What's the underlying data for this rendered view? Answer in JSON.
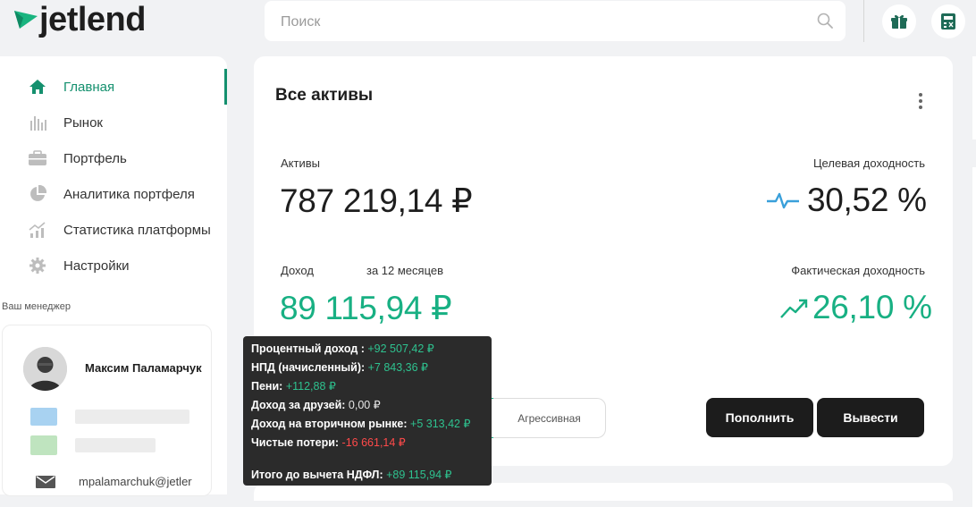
{
  "app": {
    "logo_text": "jetlend"
  },
  "search": {
    "placeholder": "Поиск"
  },
  "sidebar": {
    "items": [
      {
        "label": "Главная"
      },
      {
        "label": "Рынок"
      },
      {
        "label": "Портфель"
      },
      {
        "label": "Аналитика портфеля"
      },
      {
        "label": "Статистика платформы"
      },
      {
        "label": "Настройки"
      }
    ],
    "manager_label": "Ваш менеджер",
    "manager_name": "Максим Паламарчук",
    "manager_email": "mpalamarchuk@jetler"
  },
  "main": {
    "title": "Все активы",
    "assets_label": "Активы",
    "assets_value": "787 219,14 ₽",
    "target_label": "Целевая доходность",
    "target_value": "30,52 %",
    "income_label": "Доход",
    "income_period": "за 12 месяцев",
    "income_value": "89 115,94 ₽",
    "actual_label": "Фактическая доходность",
    "actual_value": "26,10 %",
    "strategy_label": "Агрессивная",
    "deposit_label": "Пополнить",
    "withdraw_label": "Вывести"
  },
  "tooltip": {
    "rows": [
      {
        "label": "Процентный доход : ",
        "value": "+92 507,42 ₽",
        "tone": "pos"
      },
      {
        "label": "НПД (начисленный): ",
        "value": "+7 843,36 ₽",
        "tone": "pos"
      },
      {
        "label": "Пени: ",
        "value": "+112,88 ₽",
        "tone": "pos"
      },
      {
        "label": "Доход за друзей: ",
        "value": "0,00 ₽",
        "tone": "neu"
      },
      {
        "label": "Доход на вторичном рынке: ",
        "value": "+5 313,42 ₽",
        "tone": "pos"
      },
      {
        "label": "Чистые потери: ",
        "value": "-16 661,14 ₽",
        "tone": "neg"
      }
    ],
    "total_label": "Итого до вычета НДФЛ: ",
    "total_value": "+89 115,94 ₽"
  },
  "colors": {
    "accent": "#14906e",
    "positive": "#18b083",
    "negative": "#ff4a4a",
    "dark": "#1c1c1c"
  },
  "icons": [
    "logo-icon",
    "search-icon",
    "gift-icon",
    "calculator-icon",
    "home-icon",
    "market-icon",
    "briefcase-icon",
    "pie-chart-icon",
    "stats-icon",
    "gear-icon",
    "pulse-icon",
    "trend-up-icon",
    "mail-icon",
    "more-vertical-icon"
  ]
}
